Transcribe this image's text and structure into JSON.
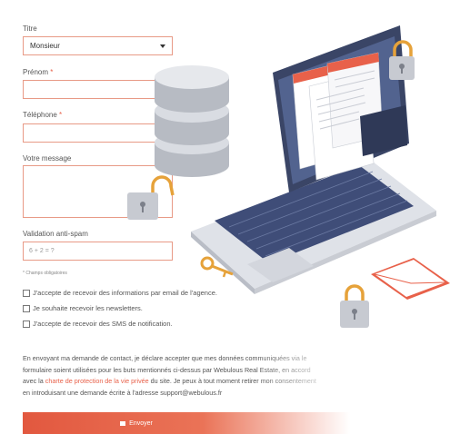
{
  "form": {
    "titre_label": "Titre",
    "titre_value": "Monsieur",
    "prenom_label": "Prénom",
    "telephone_label": "Téléphone",
    "message_label": "Votre message",
    "required_mark": "*",
    "antispam_label": "Validation anti-spam",
    "antispam_placeholder": "6 + 2 = ?",
    "required_note": "* Champs obligatoires",
    "checkbox_agency": "J'accepte de recevoir des informations par email de l'agence.",
    "checkbox_newsletter": "Je souhaite recevoir les newsletters.",
    "checkbox_sms": "J'accepte de recevoir des SMS de notification.",
    "consent_part1": "En envoyant ma demande de contact, je déclare accepter que mes données communiquées via le formulaire soient utilisées pour les buts mentionnés ci-dessus par Webulous Real Estate, en accord avec la ",
    "consent_link": "charte de protection de la vie privée",
    "consent_part2": " du site. Je peux à tout moment retirer mon consentement en introduisant une demande écrite à l'adresse support@webulous.fr",
    "send_label": "Envoyer"
  },
  "colors": {
    "accent": "#e8614a",
    "field_border": "#e89a86",
    "laptop_screen": "#4a5a86"
  },
  "icons": [
    "database-icon",
    "laptop-icon",
    "padlock-icon",
    "key-icon",
    "envelope-icon",
    "send-icon"
  ]
}
